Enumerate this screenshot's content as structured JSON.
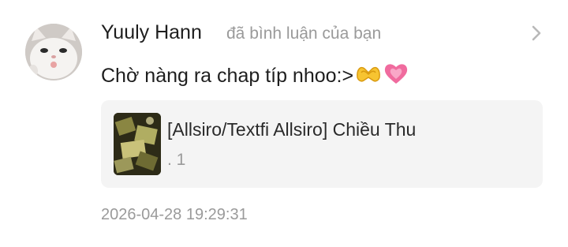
{
  "notification": {
    "username": "Yuuly Hann",
    "action_text": "đã bình luận của bạn",
    "comment_text": "Chờ nàng ra chap típ nhoo:>",
    "comment_emojis": [
      "heart-hands-emoji",
      "growing-heart-emoji"
    ],
    "timestamp": "2026-04-28 19:29:31",
    "chevron_icon": "chevron-right-icon",
    "avatar": "cat-avatar",
    "card": {
      "title": "[Allsiro/Textfi Allsiro] Chiều Thu",
      "subtitle": ". 1",
      "thumbnail": "story-cover-thumbnail"
    }
  },
  "colors": {
    "primary_text": "#1e1e1e",
    "secondary_text": "#9a9a9a",
    "card_background": "#f4f4f4",
    "page_background": "#ffffff"
  }
}
